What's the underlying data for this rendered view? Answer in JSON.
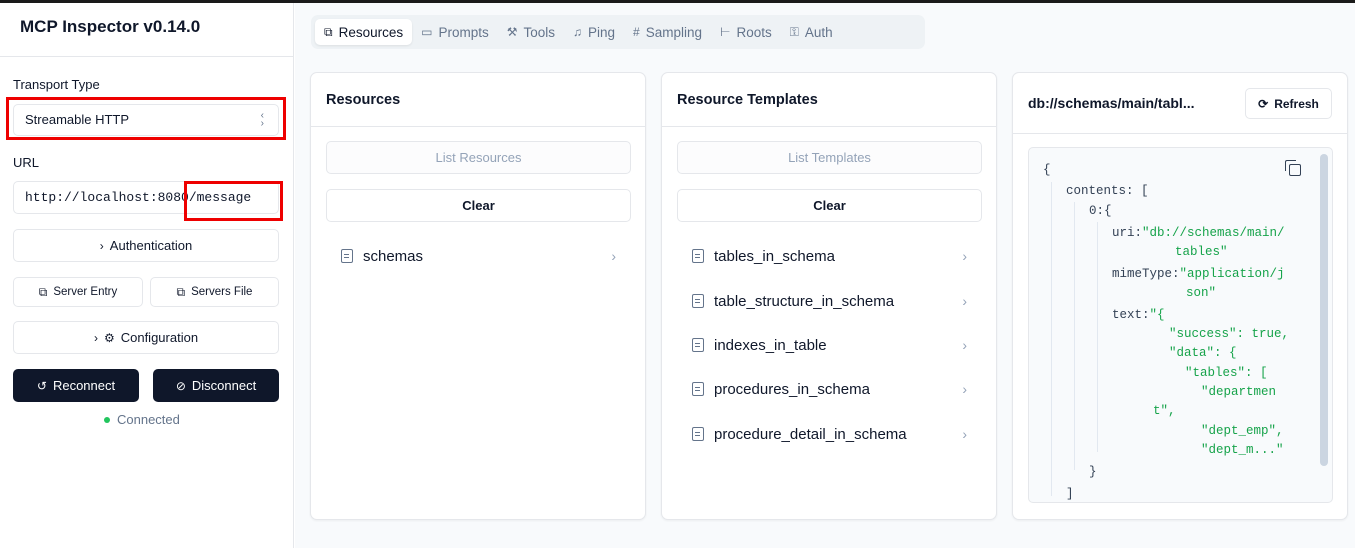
{
  "sidebar": {
    "title": "MCP Inspector v0.14.0",
    "transport_label": "Transport Type",
    "transport_value": "Streamable HTTP",
    "url_label": "URL",
    "url_value": "http://localhost:8080/message",
    "authentication_label": "Authentication",
    "server_entry_label": "Server Entry",
    "servers_file_label": "Servers File",
    "configuration_label": "Configuration",
    "reconnect_label": "Reconnect",
    "disconnect_label": "Disconnect",
    "status_text": "Connected",
    "status_color": "#22c55e"
  },
  "tabs": [
    {
      "label": "Resources",
      "icon": "files-icon"
    },
    {
      "label": "Prompts",
      "icon": "message-icon"
    },
    {
      "label": "Tools",
      "icon": "hammer-icon"
    },
    {
      "label": "Ping",
      "icon": "bell-icon"
    },
    {
      "label": "Sampling",
      "icon": "hash-icon"
    },
    {
      "label": "Roots",
      "icon": "folder-tree-icon"
    },
    {
      "label": "Auth",
      "icon": "key-icon"
    }
  ],
  "resources": {
    "title": "Resources",
    "list_label": "List Resources",
    "clear_label": "Clear",
    "items": [
      "schemas"
    ]
  },
  "templates": {
    "title": "Resource Templates",
    "list_label": "List Templates",
    "clear_label": "Clear",
    "items": [
      "tables_in_schema",
      "table_structure_in_schema",
      "indexes_in_table",
      "procedures_in_schema",
      "procedure_detail_in_schema"
    ]
  },
  "detail": {
    "title": "db://schemas/main/tabl...",
    "refresh_label": "Refresh",
    "json_lines": [
      {
        "key": "{",
        "val": ""
      },
      {
        "key": "contents:",
        "val": "["
      },
      {
        "key": "0:",
        "val": "{"
      },
      {
        "key": "uri:",
        "val": "\"db://schemas/main/"
      },
      {
        "key": "",
        "val": "tables\""
      },
      {
        "key": "mimeType:",
        "val": "\"application/j"
      },
      {
        "key": "",
        "val": "son\""
      },
      {
        "key": "text:",
        "val": "\"{"
      },
      {
        "key": "",
        "val": "\"success\": true,"
      },
      {
        "key": "",
        "val": "\"data\": {"
      },
      {
        "key": "",
        "val": "\"tables\": ["
      },
      {
        "key": "",
        "val": "\"departmen"
      },
      {
        "key": "",
        "val": "t\","
      },
      {
        "key": "",
        "val": "\"dept_emp\","
      },
      {
        "key": "",
        "val": "\"dept_m...\""
      },
      {
        "key": "}",
        "val": ""
      },
      {
        "key": "]",
        "val": ""
      }
    ]
  }
}
